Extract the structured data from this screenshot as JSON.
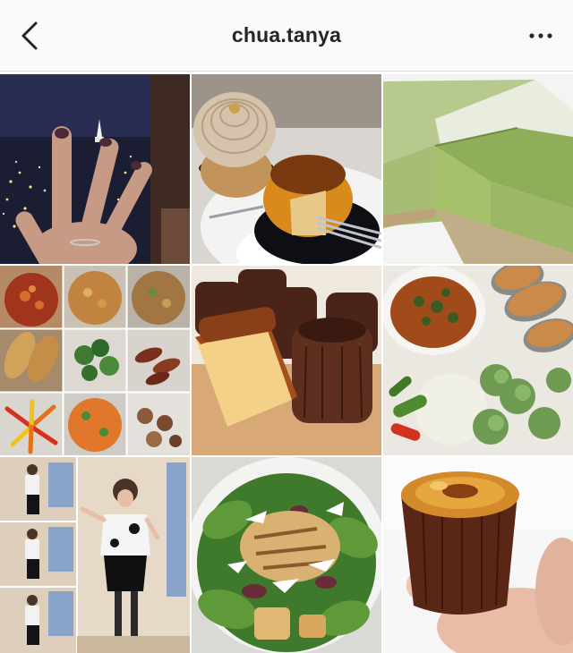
{
  "header": {
    "username": "chua.tanya",
    "back_icon": "chevron-left-icon",
    "more_icon": "more-horizontal-icon"
  },
  "posts": [
    {
      "name": "post-city-night-hand"
    },
    {
      "name": "post-mont-blanc-cake"
    },
    {
      "name": "post-matcha-cheesecake"
    },
    {
      "name": "post-meal-prep-collage"
    },
    {
      "name": "post-caneles-board"
    },
    {
      "name": "post-curry-vegetables"
    },
    {
      "name": "post-fashion-collage"
    },
    {
      "name": "post-caesar-salad"
    },
    {
      "name": "post-single-canele"
    }
  ]
}
